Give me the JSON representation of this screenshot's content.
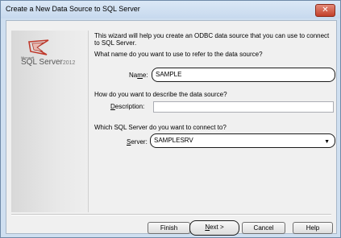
{
  "window": {
    "title": "Create a New Data Source to SQL Server",
    "close_glyph": "✕"
  },
  "logo": {
    "small_text": "Microsoft",
    "product": "SQL Server",
    "year": "2012"
  },
  "intro": "This wizard will help you create an ODBC data source that you can use to connect to SQL Server.",
  "name_question": "What name do you want to use to refer to the data source?",
  "name_label_pre": "Na",
  "name_label_key": "m",
  "name_label_post": "e:",
  "name_value": "SAMPLE",
  "desc_question": "How do you want to describe the data source?",
  "desc_label_key": "D",
  "desc_label_post": "escription:",
  "desc_value": "",
  "server_question": "Which SQL Server do you want to connect to?",
  "server_label_key": "S",
  "server_label_post": "erver:",
  "server_value": "SAMPLESRV",
  "buttons": {
    "finish": "Finish",
    "next_key": "N",
    "next_rest": "ext >",
    "cancel": "Cancel",
    "help": "Help"
  },
  "icons": {
    "close": "close-icon",
    "dropdown": "chevron-down-icon",
    "logo": "sql-server-logo-icon"
  }
}
